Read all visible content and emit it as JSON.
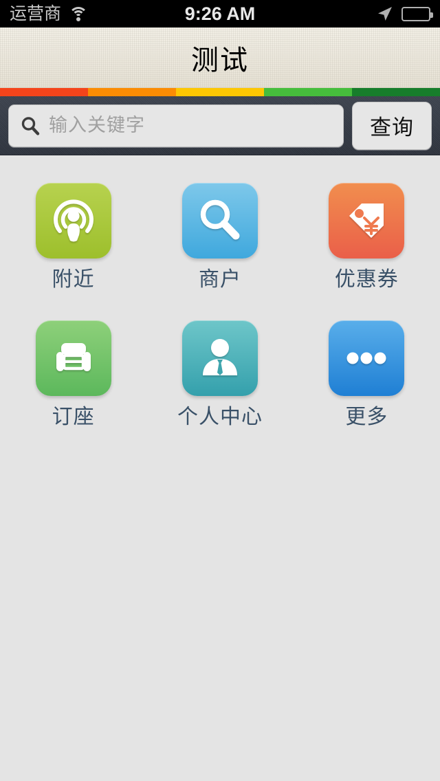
{
  "status_bar": {
    "carrier": "运营商",
    "time": "9:26 AM",
    "wifi_icon": "wifi-icon",
    "location_icon": "location-arrow-icon",
    "battery_icon": "battery-icon"
  },
  "nav": {
    "title": "测试"
  },
  "stripe": {
    "colors": [
      "#f4441b",
      "#fb8c04",
      "#fdc703",
      "#46bd3c",
      "#177d2b"
    ]
  },
  "search": {
    "placeholder": "输入关键字",
    "value": "",
    "icon": "search-icon",
    "button_label": "查询"
  },
  "grid": {
    "items": [
      {
        "label": "附近",
        "icon": "nearby-signal-person-icon",
        "color_top": "#b7d24f",
        "color_bottom": "#9dbf2c"
      },
      {
        "label": "商户",
        "icon": "magnifier-icon",
        "color_top": "#7ec8ea",
        "color_bottom": "#3fa8dd"
      },
      {
        "label": "优惠券",
        "icon": "price-tag-yen-icon",
        "color_top": "#f18e4e",
        "color_bottom": "#ea5f49"
      },
      {
        "label": "订座",
        "icon": "armchair-icon",
        "color_top": "#8ed07a",
        "color_bottom": "#5cb85c"
      },
      {
        "label": "个人中心",
        "icon": "person-tie-icon",
        "color_top": "#6ec6c9",
        "color_bottom": "#34a0ac"
      },
      {
        "label": "更多",
        "icon": "ellipsis-icon",
        "color_top": "#59aeea",
        "color_bottom": "#1f7fd4"
      }
    ],
    "label_color": "#3a5168"
  },
  "theme": {
    "body_background": "#e4e4e4",
    "navbar_background": "#ece8dd",
    "searchbar_background": "#363c47"
  }
}
